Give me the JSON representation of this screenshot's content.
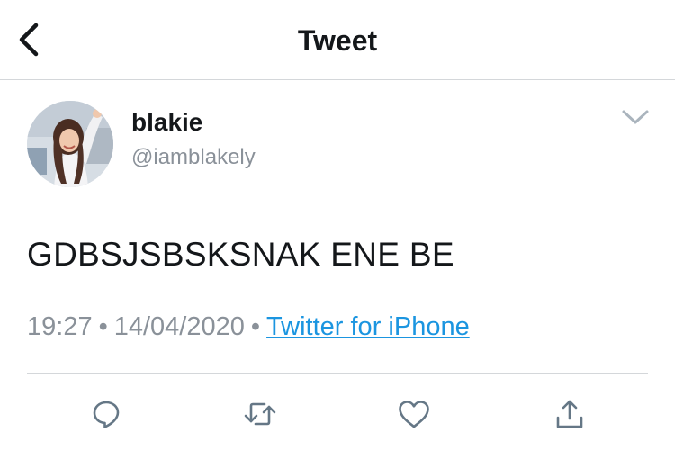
{
  "header": {
    "title": "Tweet",
    "back_icon": "chevron-left-icon"
  },
  "tweet": {
    "author": {
      "display_name": "blakie",
      "handle": "@iamblakely",
      "avatar": "profile-photo"
    },
    "text": "GDBSJSBSKSNAK ENE BE",
    "time": "19:27",
    "date": "14/04/2020",
    "separator": "•",
    "source": "Twitter for iPhone",
    "menu_icon": "chevron-down-icon"
  },
  "actions": [
    {
      "name": "reply",
      "icon": "reply-icon"
    },
    {
      "name": "retweet",
      "icon": "retweet-icon"
    },
    {
      "name": "like",
      "icon": "heart-icon"
    },
    {
      "name": "share",
      "icon": "share-icon"
    }
  ],
  "colors": {
    "text": "#14171a",
    "secondary": "#8a9199",
    "link": "#1b95e0",
    "divider": "#d4d7da",
    "icon": "#657786"
  }
}
